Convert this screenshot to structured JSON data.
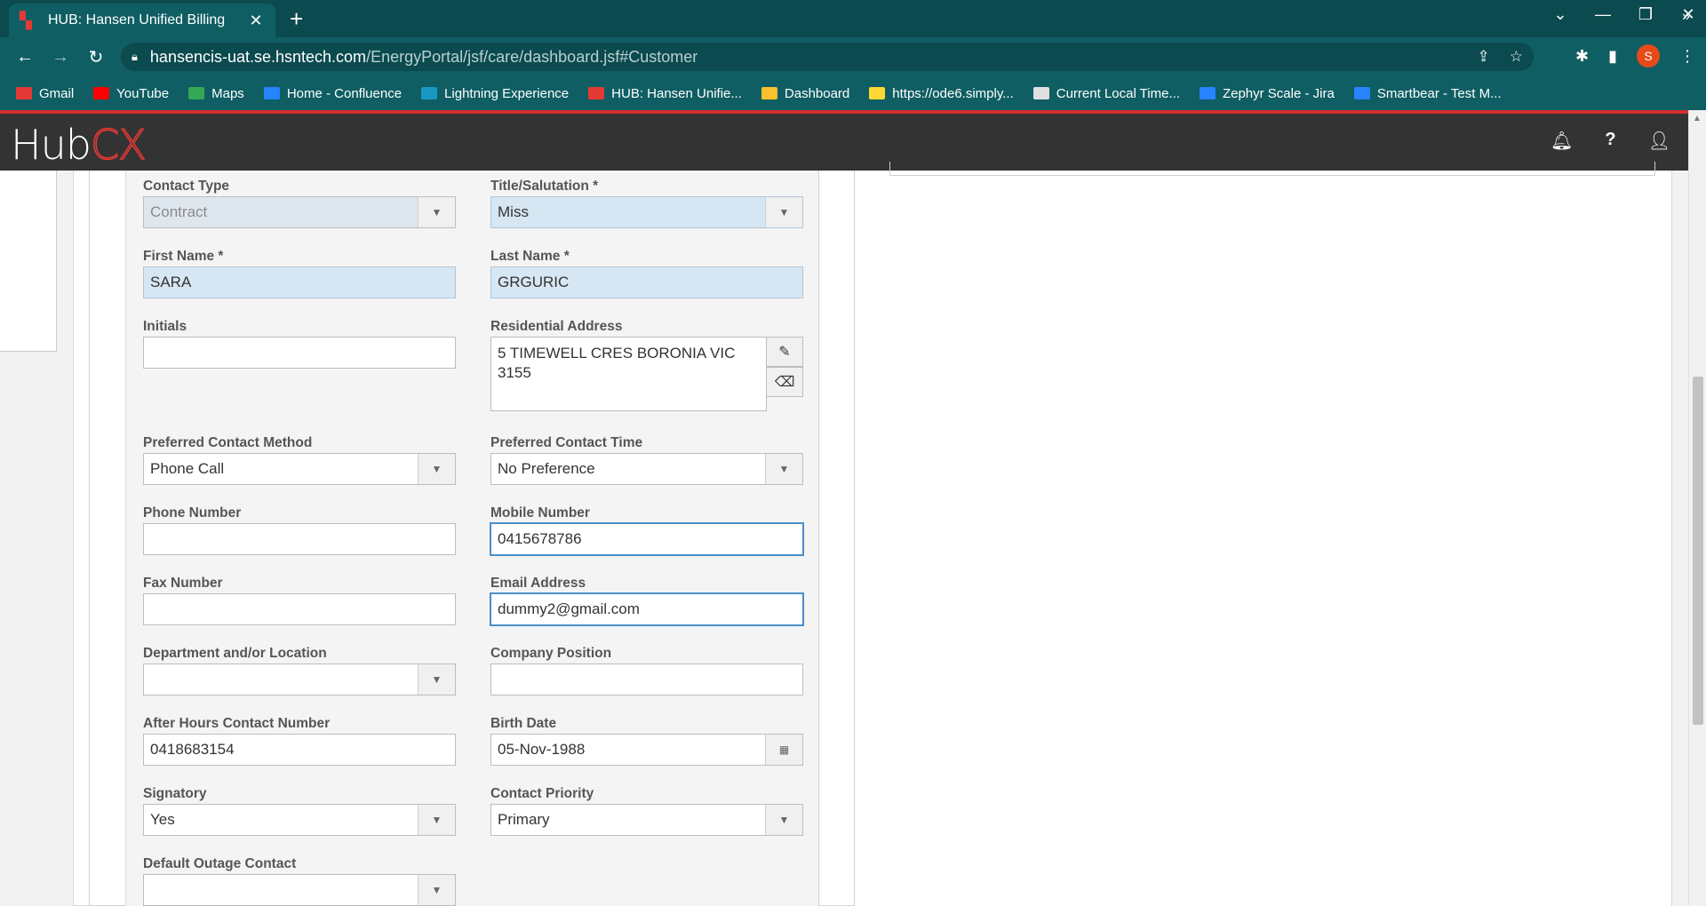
{
  "browser": {
    "tab_title": "HUB: Hansen Unified Billing",
    "url_host": "hansencis-uat.se.hsntech.com",
    "url_path": "/EnergyPortal/jsf/care/dashboard.jsf#Customer",
    "profile_initial": "S",
    "bookmarks": [
      {
        "label": "Gmail",
        "icon_color": "#e53935"
      },
      {
        "label": "YouTube",
        "icon_color": "#ff0000"
      },
      {
        "label": "Maps",
        "icon_color": "#34a853"
      },
      {
        "label": "Home - Confluence",
        "icon_color": "#2684ff"
      },
      {
        "label": "Lightning Experience",
        "icon_color": "#1798c1"
      },
      {
        "label": "HUB: Hansen Unifie...",
        "icon_color": "#e53935"
      },
      {
        "label": "Dashboard",
        "icon_color": "#fbc02d"
      },
      {
        "label": "https://ode6.simply...",
        "icon_color": "#fdd835"
      },
      {
        "label": "Current Local Time...",
        "icon_color": "#e0e0e0"
      },
      {
        "label": "Zephyr Scale - Jira",
        "icon_color": "#2684ff"
      },
      {
        "label": "Smartbear - Test M...",
        "icon_color": "#2684ff"
      }
    ]
  },
  "app": {
    "logo_hub": "Hub",
    "logo_cx": "CX"
  },
  "form": {
    "contact_type": {
      "label": "Contact Type",
      "value": "Contract"
    },
    "title": {
      "label": "Title/Salutation *",
      "value": "Miss"
    },
    "first_name": {
      "label": "First Name *",
      "value": "SARA"
    },
    "last_name": {
      "label": "Last Name *",
      "value": "GRGURIC"
    },
    "initials": {
      "label": "Initials",
      "value": ""
    },
    "residential_address": {
      "label": "Residential Address",
      "value": "5 TIMEWELL CRES BORONIA  VIC 3155"
    },
    "preferred_contact_method": {
      "label": "Preferred Contact Method",
      "value": "Phone Call"
    },
    "preferred_contact_time": {
      "label": "Preferred Contact Time",
      "value": "No Preference"
    },
    "phone_number": {
      "label": "Phone Number",
      "value": ""
    },
    "mobile_number": {
      "label": "Mobile Number",
      "value": "0415678786"
    },
    "fax_number": {
      "label": "Fax Number",
      "value": ""
    },
    "email_address": {
      "label": "Email Address",
      "value": "dummy2@gmail.com"
    },
    "department": {
      "label": "Department and/or Location",
      "value": ""
    },
    "company_position": {
      "label": "Company Position",
      "value": ""
    },
    "after_hours": {
      "label": "After Hours Contact Number",
      "value": "0418683154"
    },
    "birth_date": {
      "label": "Birth Date",
      "value": "05-Nov-1988"
    },
    "signatory": {
      "label": "Signatory",
      "value": "Yes"
    },
    "contact_priority": {
      "label": "Contact Priority",
      "value": "Primary"
    },
    "default_outage": {
      "label": "Default Outage Contact",
      "value": ""
    }
  }
}
